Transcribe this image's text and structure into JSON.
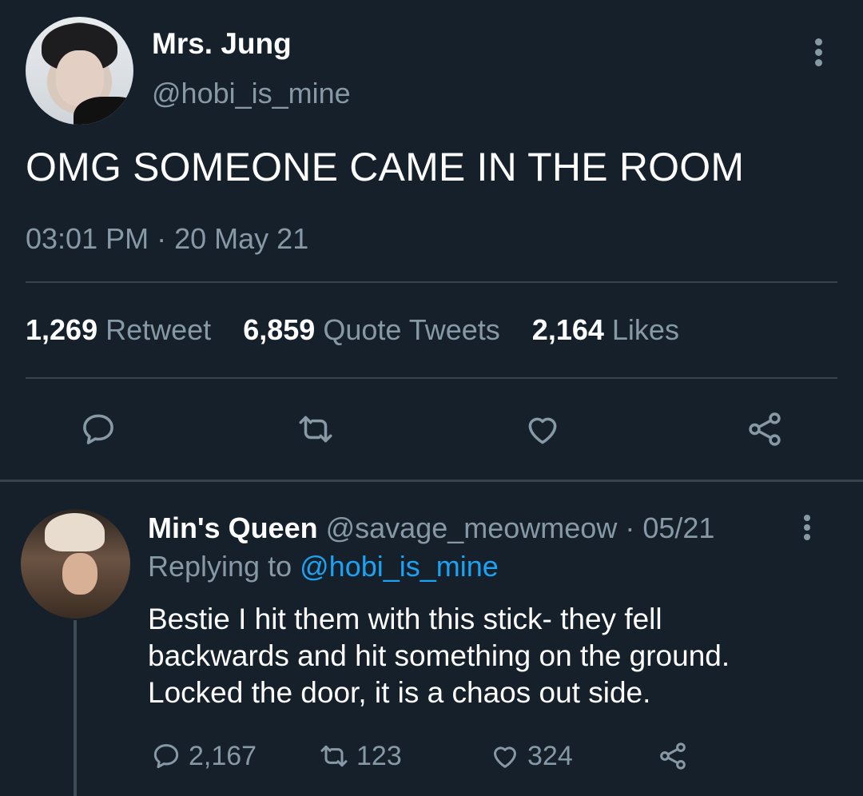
{
  "tweet": {
    "author_name": "Mrs. Jung",
    "author_handle": "@hobi_is_mine",
    "text": "OMG SOMEONE CAME IN THE ROOM",
    "time": "03:01 PM",
    "separator": "·",
    "date": "20 May 21",
    "stats": {
      "retweets": "1,269",
      "retweets_label": "Retweet",
      "quotes": "6,859",
      "quotes_label": "Quote Tweets",
      "likes": "2,164",
      "likes_label": "Likes"
    },
    "actions": [
      "reply-icon",
      "retweet-icon",
      "heart-icon",
      "share-icon"
    ]
  },
  "reply": {
    "author_name": "Min's Queen",
    "author_handle": "@savage_meowmeow",
    "separator": "·",
    "date": "05/21",
    "replying_prefix": "Replying to",
    "replying_to": "@hobi_is_mine",
    "text_lines": [
      "Bestie I hit them with this stick- they fell",
      "backwards and hit something on the ground.",
      "Locked the door, it is a chaos out side."
    ],
    "reply_count": "2,167",
    "retweet_count": "123",
    "like_count": "324"
  },
  "colors": {
    "background": "#15202b",
    "muted_text": "#8899a6",
    "link": "#1da1f2",
    "divider": "#38444d"
  }
}
